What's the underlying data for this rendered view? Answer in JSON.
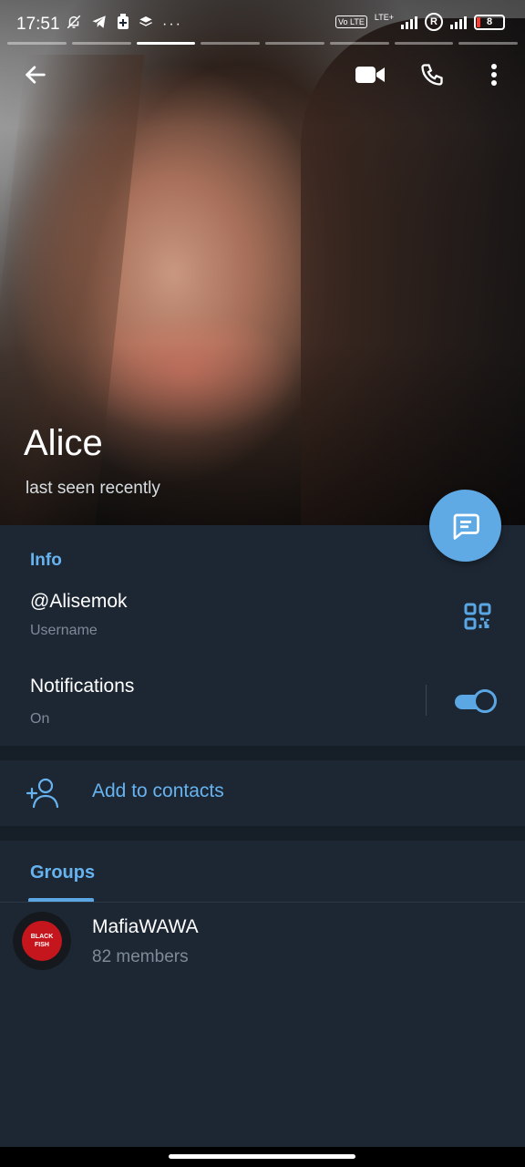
{
  "status_bar": {
    "time": "17:51",
    "left_icons": [
      "mute-bell-icon",
      "telegram-icon",
      "battery-saver-icon",
      "layers-icon",
      "more-dots"
    ],
    "lte_label": "LTE+",
    "volte_label": "Vo LTE",
    "r_label": "R",
    "battery_level": "8"
  },
  "story_segments": {
    "count": 8,
    "active_index": 2
  },
  "profile": {
    "name": "Alice",
    "status": "last seen recently"
  },
  "info": {
    "section_title": "Info",
    "username": "@Alisemok",
    "username_label": "Username",
    "notifications_label": "Notifications",
    "notifications_value": "On",
    "notifications_enabled": true
  },
  "actions": {
    "add_to_contacts": "Add to contacts"
  },
  "groups": {
    "tab_label": "Groups",
    "items": [
      {
        "name": "MafiaWAWA",
        "members": "82 members",
        "avatar_text_line1": "BLACK",
        "avatar_text_line2": "FISH"
      }
    ]
  },
  "colors": {
    "accent": "#67b3f0",
    "background": "#1d2733",
    "fab": "#5fa9e4"
  }
}
